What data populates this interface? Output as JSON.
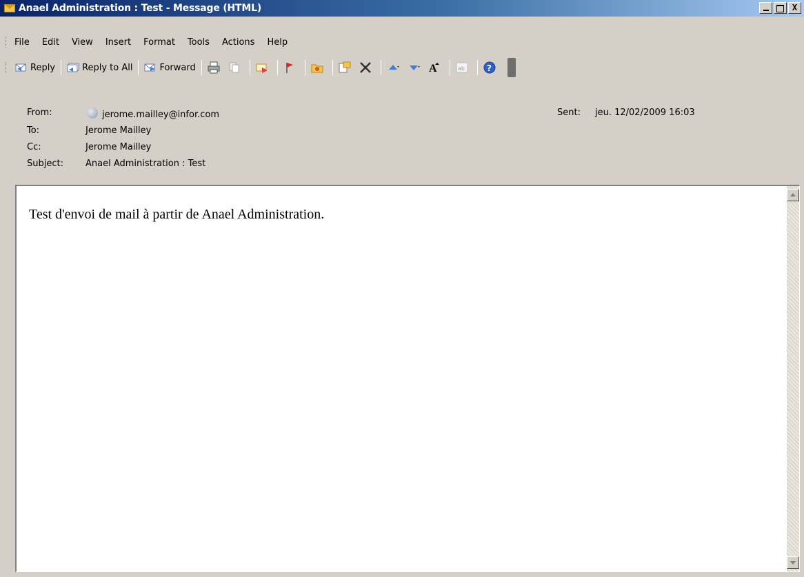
{
  "window": {
    "title": "Anael Administration : Test - Message (HTML)",
    "controls": {
      "minimize": "_",
      "maximize": "□",
      "close": "X"
    }
  },
  "menu": {
    "items": [
      "File",
      "Edit",
      "View",
      "Insert",
      "Format",
      "Tools",
      "Actions",
      "Help"
    ]
  },
  "toolbar": {
    "reply_label": "Reply",
    "reply_all_label": "Reply to All",
    "forward_label": "Forward",
    "icons": [
      "print-icon",
      "copy-icon",
      "move-to-folder-icon",
      "flag-icon",
      "address-book-icon",
      "copy-to-folder-icon",
      "delete-icon",
      "previous-item-icon",
      "next-item-icon",
      "font-size-icon",
      "encoding-icon",
      "help-icon"
    ]
  },
  "header": {
    "from_label": "From:",
    "from_value": "jerome.mailley@infor.com",
    "to_label": "To:",
    "to_value": "Jerome Mailley",
    "cc_label": "Cc:",
    "cc_value": "Jerome Mailley",
    "subject_label": "Subject:",
    "subject_value": "Anael Administration : Test",
    "sent_label": "Sent:",
    "sent_value": "jeu. 12/02/2009 16:03"
  },
  "message": {
    "body": "Test d'envoi de mail à partir de Anael Administration."
  },
  "colors": {
    "chrome": "#d4d0c8",
    "title_start": "#0a246a",
    "title_end": "#a6caf0"
  }
}
